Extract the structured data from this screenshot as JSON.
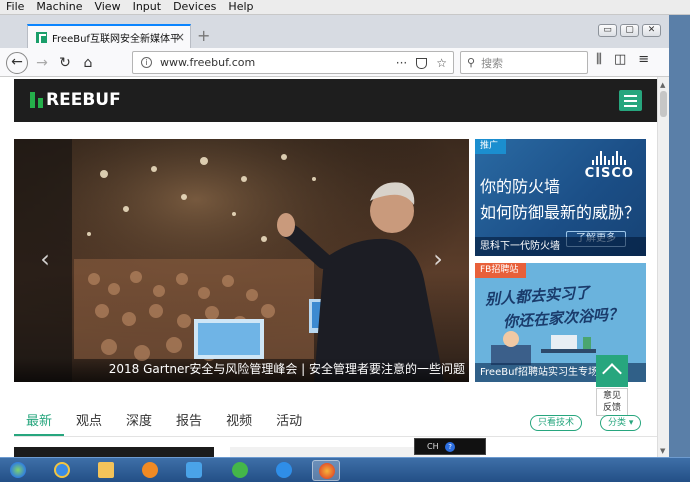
{
  "vm_menu": [
    "File",
    "Machine",
    "View",
    "Input",
    "Devices",
    "Help"
  ],
  "browser": {
    "tab_title": "FreeBuf互联网安全新媒体平台",
    "tab_close": "×",
    "new_tab": "+",
    "url": "www.freebuf.com",
    "search_placeholder": "搜索",
    "url_actions": [
      "···",
      "☆"
    ],
    "window_buttons": [
      "▭",
      "▢",
      "✕"
    ]
  },
  "site": {
    "logo_text": "REEBUF",
    "carousel_caption": "2018 Gartner安全与风险管理峰会 | 安全管理者要注意的一些问题",
    "carousel_prev": "‹",
    "carousel_next": "›",
    "ad1": {
      "badge": "推广",
      "brand": "CISCO",
      "line1": "你的防火墙",
      "line2": "如何防御最新的威胁？",
      "button": "了解更多",
      "footer": "思科下一代防火墙"
    },
    "ad2": {
      "badge": "FB招聘站",
      "hand1": "别人都去实习了",
      "hand2": "你还在家次浴吗？",
      "footer": "FreeBuf招聘站实习生专场"
    },
    "feedback": "意见\n反馈",
    "tabs": [
      "最新",
      "观点",
      "深度",
      "报告",
      "视频",
      "活动"
    ],
    "tech_filter": "只看技术",
    "category": "分类 ▾"
  },
  "taskbar": {
    "ime_label": "CH"
  },
  "colors": {
    "brand_green": "#27a67e",
    "header_black": "#1e1e1e",
    "tab_highlight": "#0a84ff"
  }
}
